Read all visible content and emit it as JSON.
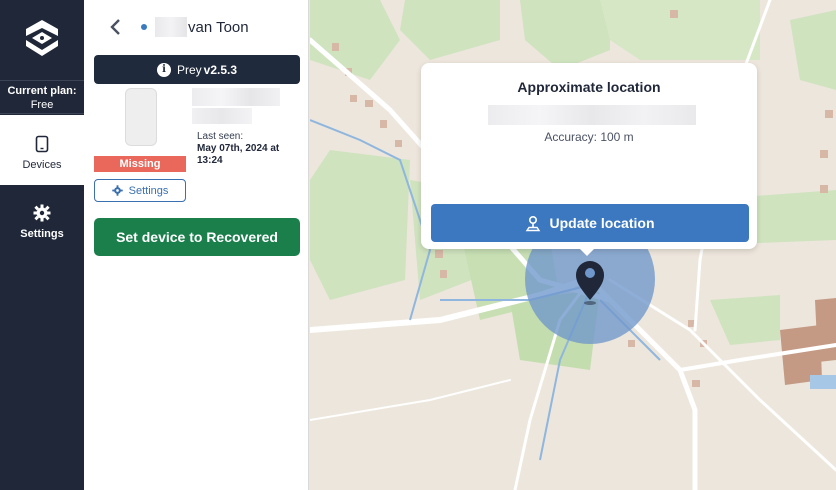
{
  "nav": {
    "current_plan_label": "Current plan:",
    "current_plan_value": "Free",
    "items": [
      {
        "label": "Devices",
        "icon": "tablet-icon",
        "active": true
      },
      {
        "label": "Settings",
        "icon": "gear-icon",
        "active": false
      }
    ]
  },
  "device": {
    "name": "van Toon",
    "version_prefix": "Prey",
    "version": "v2.5.3",
    "status_badge": "Missing",
    "settings_label": "Settings",
    "last_seen_label": "Last seen:",
    "last_seen_value": "May 07th, 2024 at 13:24",
    "recover_label": "Set device to Recovered"
  },
  "map_popup": {
    "title": "Approximate location",
    "accuracy": "Accuracy: 100 m",
    "update_label": "Update location"
  },
  "colors": {
    "rail": "#1f2738",
    "missing": "#e9685b",
    "recover": "#1b7f4c",
    "update": "#3b78c0",
    "accuracy_circle": "#6f97cc"
  }
}
